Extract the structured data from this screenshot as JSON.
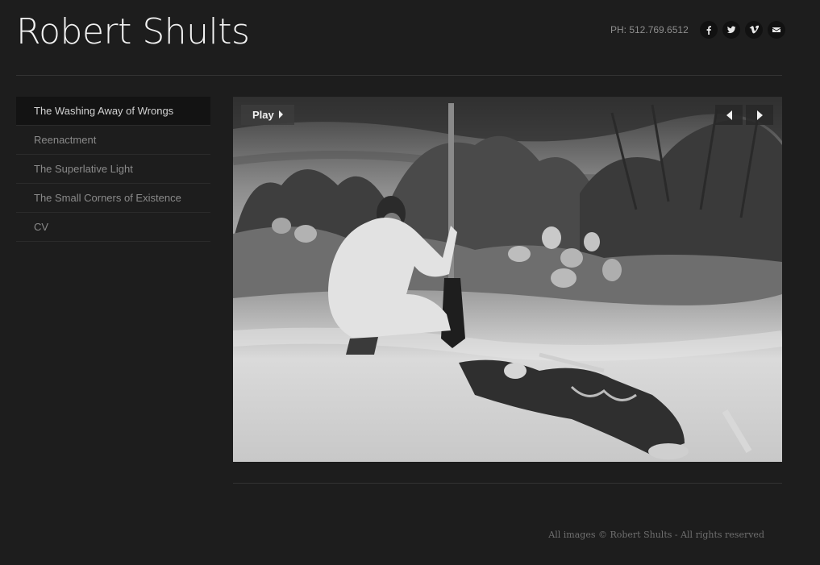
{
  "site": {
    "title": "Robert Shults"
  },
  "header": {
    "phone": "PH: 512.769.6512",
    "social": [
      {
        "icon": "facebook-icon"
      },
      {
        "icon": "twitter-icon"
      },
      {
        "icon": "vimeo-icon"
      },
      {
        "icon": "email-icon"
      }
    ]
  },
  "sidebar": {
    "items": [
      {
        "label": "The Washing Away of Wrongs",
        "active": true
      },
      {
        "label": "Reenactment",
        "active": false
      },
      {
        "label": "The Superlative Light",
        "active": false
      },
      {
        "label": "The Small Corners of Existence",
        "active": false
      },
      {
        "label": "CV",
        "active": false
      }
    ]
  },
  "slideshow": {
    "play_label": "Play",
    "prev_icon": "arrow-left-icon",
    "next_icon": "arrow-right-icon"
  },
  "footer": {
    "copyright": "All images © Robert Shults - All rights reserved"
  }
}
